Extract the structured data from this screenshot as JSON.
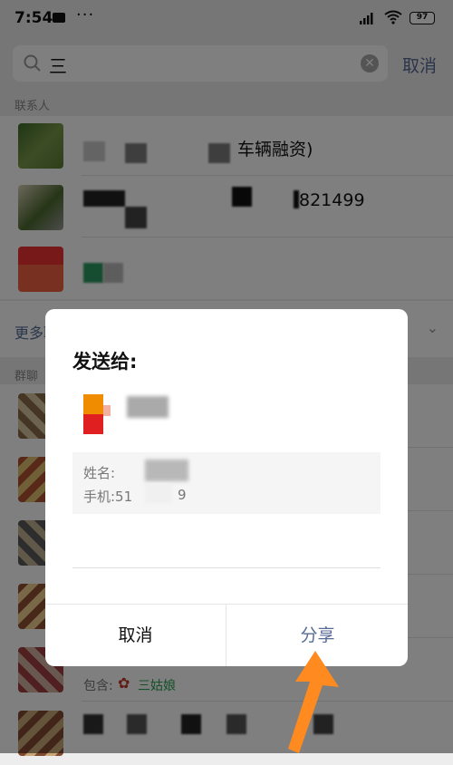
{
  "status_bar": {
    "time": "7:54",
    "dots": "···",
    "battery": "97"
  },
  "search": {
    "query": "三",
    "cancel_label": "取消"
  },
  "sections": {
    "contacts": "联系人",
    "more": "更多联系人",
    "groups": "群聊"
  },
  "contacts": [
    {
      "visible_text": "车辆融资)"
    },
    {
      "visible_text": "821499"
    },
    {
      "visible_text": ""
    }
  ],
  "groups": [
    {
      "contains_label": "",
      "member": ""
    },
    {
      "contains_label": "",
      "member": ""
    },
    {
      "contains_label": "",
      "member": ""
    },
    {
      "contains_label": "",
      "member": ""
    },
    {
      "contains_label": "包含:",
      "member": "三姑娘"
    },
    {
      "contains_label": "",
      "member": ""
    }
  ],
  "dialog": {
    "title": "发送给:",
    "card_name_label": "姓名:",
    "card_phone_label": "手机:51",
    "card_phone_tail": "9",
    "cancel_label": "取消",
    "share_label": "分享"
  },
  "colors": {
    "accent": "#576b95",
    "arrow": "#ff8a1f"
  }
}
